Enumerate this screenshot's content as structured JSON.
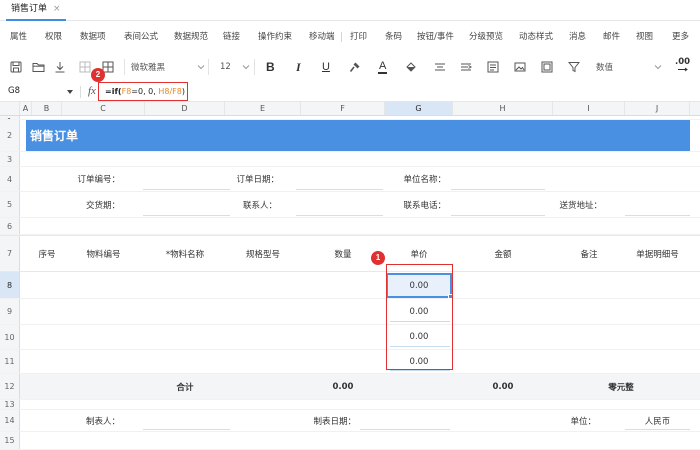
{
  "tabs": [
    {
      "label": "销售订单",
      "close": "×"
    }
  ],
  "menu": [
    "属性",
    "权限",
    "数据项",
    "表间公式",
    "数据规范",
    "链接",
    "操作约束",
    "移动端",
    "打印",
    "条码",
    "按钮/事件",
    "分级预览",
    "动态样式",
    "消息",
    "邮件",
    "视图",
    "更多"
  ],
  "toolbar": {
    "icons": [
      "save-icon",
      "folder-icon",
      "download-icon",
      "border-icon",
      "merge-cells-icon",
      "format-painter-icon",
      "fill-color-icon",
      "align-icon",
      "indent-icon",
      "wrap-text-icon",
      "image-icon",
      "frame-icon",
      "filter-icon",
      "decimal-icon"
    ],
    "font_family": "微软雅黑",
    "font_size": "12",
    "bold": "B",
    "italic": "I",
    "underline": "U",
    "font_color_glyph": "A",
    "number_format": "数值",
    "decimal": ".00"
  },
  "formula_bar": {
    "cell_ref": "G8",
    "fx": "fx",
    "formula_parts": [
      "=if(",
      "F8",
      "=0, 0, ",
      "H8/F8",
      ")"
    ]
  },
  "columns": [
    "A",
    "B",
    "C",
    "D",
    "E",
    "F",
    "G",
    "H",
    "I",
    "J"
  ],
  "rows": [
    "1",
    "2",
    "3",
    "4",
    "5",
    "6",
    "7",
    "8",
    "9",
    "10",
    "11",
    "12",
    "13",
    "14",
    "15"
  ],
  "sheet": {
    "title": "销售订单",
    "r4": {
      "order_no": "订单编号：",
      "order_date": "订单日期：",
      "company": "单位名称："
    },
    "r5": {
      "delivery": "交货期：",
      "contact": "联系人：",
      "phone": "联系电话：",
      "address": "送货地址："
    },
    "headers": [
      "序号",
      "物料编号",
      "*物料名称",
      "规格型号",
      "数量",
      "单价",
      "金额",
      "备注",
      "单据明细号"
    ],
    "unit_prices": [
      "0.00",
      "0.00",
      "0.00",
      "0.00"
    ],
    "totals": {
      "label": "合计",
      "qty": "0.00",
      "amount": "0.00",
      "amount_words": "零元整"
    },
    "r14": {
      "maker": "制表人：",
      "make_date": "制表日期：",
      "unit_label": "单位：",
      "unit_value": "人民币"
    }
  },
  "annotations": {
    "badge_1": "1",
    "badge_2": "2"
  },
  "colors": {
    "accent": "#3d8de6",
    "banner": "#4a90e2",
    "annotation": "#e03030",
    "cell_ref": "#e8892c",
    "selected_fill": "#e8f1fb"
  }
}
